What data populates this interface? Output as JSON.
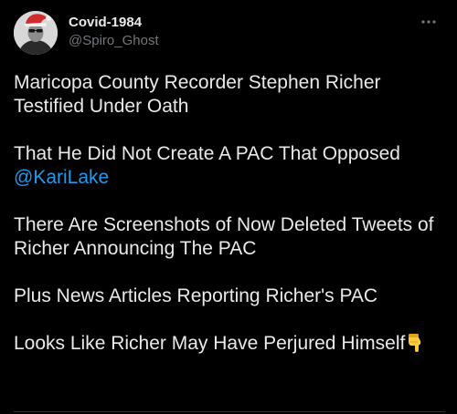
{
  "tweet": {
    "author": {
      "display_name": "Covid-1984",
      "handle": "@Spiro_Ghost"
    },
    "more_icon": "more-horizontal-icon",
    "paragraphs": [
      "Maricopa County Recorder Stephen Richer Testified Under Oath",
      "That He Did Not Create A PAC That Opposed",
      "There Are Screenshots of Now Deleted Tweets of Richer Announcing The PAC",
      "Plus News Articles Reporting Richer's PAC",
      "Looks Like Richer May Have Perjured Himself"
    ],
    "mention": "@KariLake",
    "emoji_icon": "pointing-down-hand-icon",
    "colors": {
      "background": "#000000",
      "text": "#e7e9ea",
      "secondary_text": "#71767b",
      "link": "#1d9bf0"
    }
  }
}
